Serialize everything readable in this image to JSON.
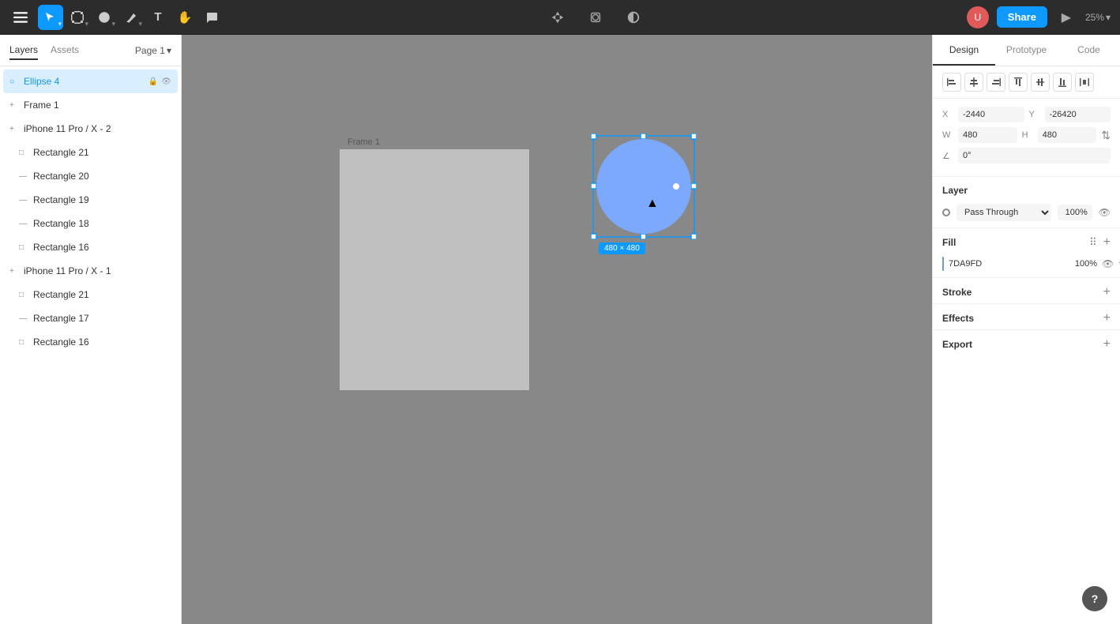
{
  "toolbar": {
    "menu_icon": "☰",
    "tools": [
      {
        "id": "select",
        "label": "Select",
        "active": true,
        "icon": "▲"
      },
      {
        "id": "frame",
        "label": "Frame",
        "icon": "⊞"
      },
      {
        "id": "shape",
        "label": "Shape",
        "icon": "○"
      },
      {
        "id": "pen",
        "label": "Pen",
        "icon": "✏"
      },
      {
        "id": "text",
        "label": "Text",
        "icon": "T"
      },
      {
        "id": "hand",
        "label": "Hand",
        "icon": "✋"
      },
      {
        "id": "comment",
        "label": "Comment",
        "icon": "💬"
      }
    ],
    "center_tools": [
      {
        "id": "component",
        "icon": "⊞"
      },
      {
        "id": "mask",
        "icon": "◈"
      },
      {
        "id": "theme",
        "icon": "◑"
      }
    ],
    "share_label": "Share",
    "zoom_label": "25%"
  },
  "left_panel": {
    "tabs": [
      "Layers",
      "Assets",
      "Page 1"
    ],
    "active_tab": "Layers",
    "layers": [
      {
        "id": "ellipse4",
        "name": "Ellipse 4",
        "indent": 0,
        "selected": true,
        "icon": "○",
        "locked": true,
        "visible": true
      },
      {
        "id": "frame1",
        "name": "Frame 1",
        "indent": 0,
        "selected": false,
        "icon": "+"
      },
      {
        "id": "iphone2",
        "name": "iPhone 11 Pro / X - 2",
        "indent": 0,
        "selected": false,
        "icon": "+"
      },
      {
        "id": "rect21a",
        "name": "Rectangle 21",
        "indent": 1,
        "selected": false,
        "icon": "□"
      },
      {
        "id": "rect20",
        "name": "Rectangle 20",
        "indent": 1,
        "selected": false,
        "icon": "—"
      },
      {
        "id": "rect19",
        "name": "Rectangle 19",
        "indent": 1,
        "selected": false,
        "icon": "—"
      },
      {
        "id": "rect18",
        "name": "Rectangle 18",
        "indent": 1,
        "selected": false,
        "icon": "—"
      },
      {
        "id": "rect16a",
        "name": "Rectangle 16",
        "indent": 1,
        "selected": false,
        "icon": "□"
      },
      {
        "id": "iphone1",
        "name": "iPhone 11 Pro / X - 1",
        "indent": 0,
        "selected": false,
        "icon": "+"
      },
      {
        "id": "rect21b",
        "name": "Rectangle 21",
        "indent": 1,
        "selected": false,
        "icon": "□"
      },
      {
        "id": "rect17",
        "name": "Rectangle 17",
        "indent": 1,
        "selected": false,
        "icon": "—"
      },
      {
        "id": "rect16b",
        "name": "Rectangle 16",
        "indent": 1,
        "selected": false,
        "icon": "□"
      }
    ]
  },
  "canvas": {
    "frame_label": "Frame 1",
    "ellipse_size": "480 × 480",
    "ellipse_color": "#7DA9FD",
    "frame_bg": "#c0c0c0"
  },
  "right_panel": {
    "tabs": [
      "Design",
      "Prototype",
      "Code"
    ],
    "active_tab": "Design",
    "align": {
      "buttons": [
        "align-left",
        "align-center-h",
        "align-right",
        "align-top",
        "align-middle-v",
        "align-bottom",
        "distribute-h"
      ]
    },
    "position": {
      "x_label": "X",
      "x_value": "-2440",
      "y_label": "Y",
      "y_value": "-26420",
      "w_label": "W",
      "w_value": "480",
      "h_label": "H",
      "h_value": "480",
      "angle_label": "∠",
      "angle_value": "0°"
    },
    "layer": {
      "section_title": "Layer",
      "blend_mode": "Pass Through",
      "opacity": "100%"
    },
    "fill": {
      "section_title": "Fill",
      "color": "#7DA9FD",
      "hex": "7DA9FD",
      "opacity": "100%"
    },
    "stroke": {
      "section_title": "Stroke"
    },
    "effects": {
      "section_title": "Effects"
    },
    "export": {
      "section_title": "Export"
    }
  },
  "help": {
    "label": "?"
  }
}
